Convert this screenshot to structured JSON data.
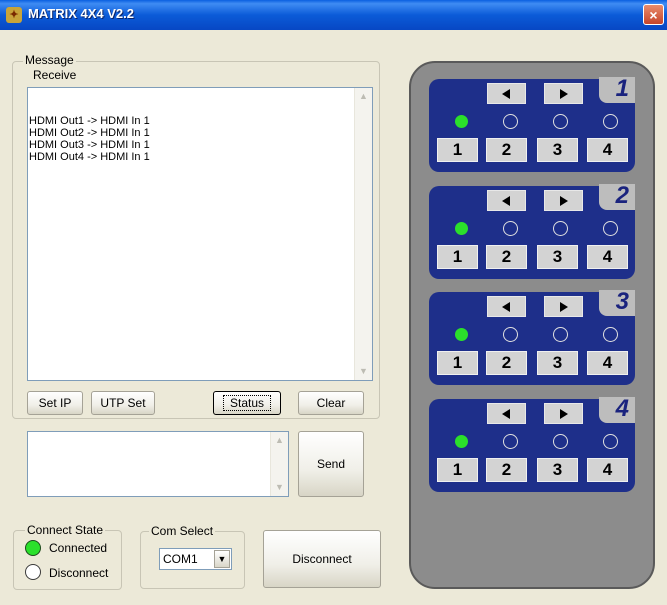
{
  "window": {
    "title": "MATRIX 4X4 V2.2",
    "close": "×"
  },
  "message": {
    "group_label": "Message",
    "receive_label": "Receive",
    "lines": [
      "HDMI Out1 -> HDMI In 1",
      "HDMI Out2 -> HDMI In 1",
      "HDMI Out3 -> HDMI In 1",
      "HDMI Out4 -> HDMI In 1"
    ],
    "send_text": ""
  },
  "buttons": {
    "set_ip": "Set IP",
    "utp_set": "UTP Set",
    "status": "Status",
    "clear": "Clear",
    "send": "Send",
    "disconnect": "Disconnect"
  },
  "connect_state": {
    "label": "Connect State",
    "connected": "Connected",
    "disconnect": "Disconnect",
    "selected": "Connected"
  },
  "com_select": {
    "label": "Com Select",
    "value": "COM1"
  },
  "matrix": {
    "outputs": [
      {
        "number": "1",
        "active_input": 1
      },
      {
        "number": "2",
        "active_input": 1
      },
      {
        "number": "3",
        "active_input": 1
      },
      {
        "number": "4",
        "active_input": 1
      }
    ],
    "input_labels": [
      "1",
      "2",
      "3",
      "4"
    ],
    "colors": {
      "panel": "#1E2F8A",
      "led_on": "#2BE02B",
      "body": "#8C8C8C"
    }
  }
}
